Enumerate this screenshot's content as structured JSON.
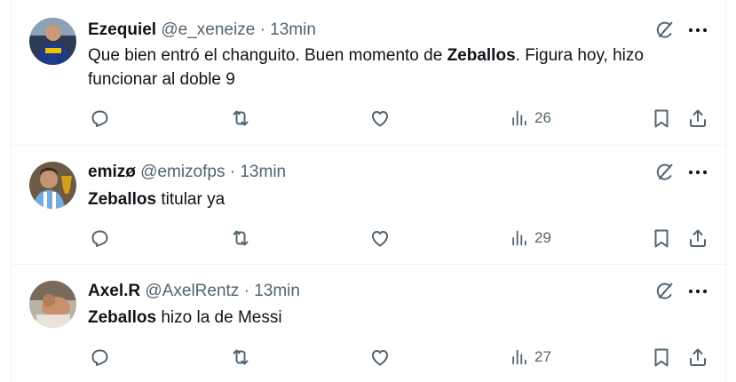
{
  "tweets": [
    {
      "name": "Ezequiel",
      "handle": "@e_xeneize",
      "separator": "·",
      "time": "13min",
      "text_pre": "Que bien entró el changuito. Buen momento de ",
      "text_bold": "Zeballos",
      "text_post": ". Figura hoy, hizo funcionar al doble 9",
      "views": "26"
    },
    {
      "name": "emizø",
      "handle": "@emizofps",
      "separator": "·",
      "time": "13min",
      "text_pre": "",
      "text_bold": "Zeballos",
      "text_post": " titular ya",
      "views": "29"
    },
    {
      "name": "Axel.R",
      "handle": "@AxelRentz",
      "separator": "·",
      "time": "13min",
      "text_pre": "",
      "text_bold": "Zeballos",
      "text_post": " hizo la de Messi",
      "views": "27"
    }
  ],
  "icons": {
    "grok": "grok-icon",
    "more": "more-icon",
    "reply": "reply-icon",
    "retweet": "retweet-icon",
    "like": "like-icon",
    "views": "views-icon",
    "bookmark": "bookmark-icon",
    "share": "share-icon"
  },
  "colors": {
    "text": "#0f1419",
    "secondary": "#536471",
    "border": "#eff3f4"
  }
}
